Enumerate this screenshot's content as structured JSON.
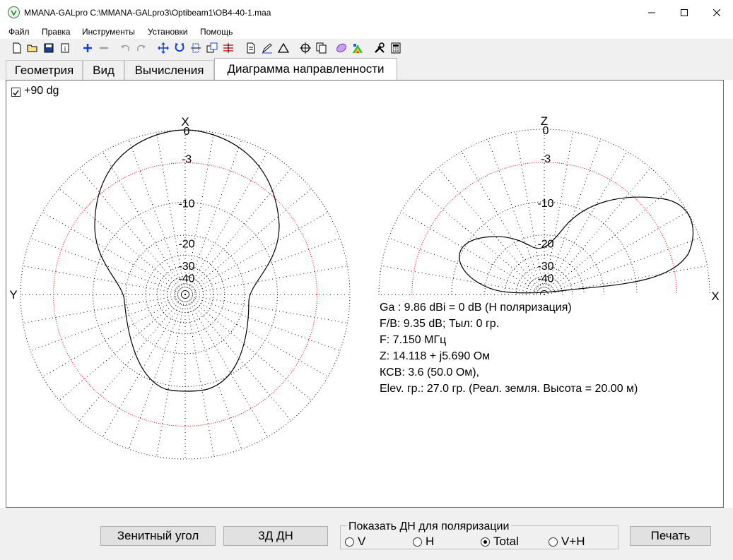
{
  "window": {
    "title": "MMANA-GALpro C:\\MMANA-GALpro3\\Optibeam1\\OB4-40-1.maa"
  },
  "menu": [
    "Файл",
    "Правка",
    "Инструменты",
    "Установки",
    "Помощь"
  ],
  "toolbar_icons": [
    "new-file-icon",
    "open-folder-icon",
    "save-icon",
    "info-icon",
    "add-icon",
    "remove-icon",
    "undo-icon",
    "redo-icon",
    "move-icon",
    "rotate-icon",
    "stretch-icon",
    "copy-icon",
    "split-icon",
    "document-icon",
    "edit-icon",
    "triangle-icon",
    "target-icon",
    "duplicate-icon",
    "pattern-icon",
    "color-chart-icon",
    "tools-icon",
    "calculator-icon"
  ],
  "tabs": [
    {
      "label": "Геометрия",
      "active": false
    },
    {
      "label": "Вид",
      "active": false
    },
    {
      "label": "Вычисления",
      "active": false
    },
    {
      "label": "Диаграмма направленности",
      "active": true
    }
  ],
  "plot": {
    "checkbox_label": "+90 dg",
    "checkbox_checked": true,
    "ring_labels": [
      "0",
      "-3",
      "-10",
      "-20",
      "-30",
      "-40"
    ],
    "horizontal": {
      "top_axis": "X",
      "left_axis": "Y"
    },
    "vertical": {
      "top_axis": "Z",
      "right_axis": "X"
    },
    "colors": {
      "pattern": "#000000",
      "grid": "#000000",
      "minus3db_ring": "#ff0000"
    }
  },
  "info": {
    "ga": "Ga : 9.86 dBi = 0 dB  (H поляризация)",
    "fb": "F/B: 9.35 dB; Тыл: 0 гр.",
    "freq": "F: 7.150 МГц",
    "impedance": "Z: 14.118 + j5.690 Ом",
    "swr": "КСВ: 3.6 (50.0 Ом),",
    "elevation": "Elev. гр.: 27.0 гр. (Реал. земля. Высота = 20.00 м)"
  },
  "buttons": {
    "zenith": "Зенитный угол",
    "pattern3d": "3Д   ДН",
    "print": "Печать"
  },
  "polarization": {
    "title": "Показать ДН для поляризации",
    "options": [
      {
        "label": "V",
        "checked": false
      },
      {
        "label": "H",
        "checked": false
      },
      {
        "label": "Total",
        "checked": true
      },
      {
        "label": "V+H",
        "checked": false
      }
    ]
  }
}
